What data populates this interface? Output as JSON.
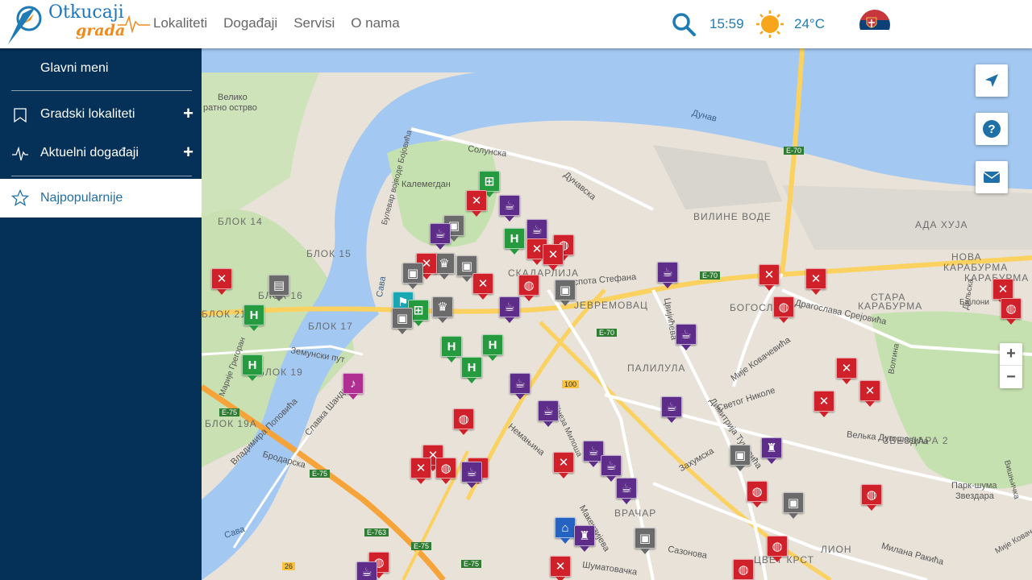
{
  "header": {
    "logo": {
      "line1": "Otkucaji",
      "line2": "grada"
    },
    "nav": [
      {
        "label": "Lokaliteti"
      },
      {
        "label": "Događaji"
      },
      {
        "label": "Servisi"
      },
      {
        "label": "O nama"
      }
    ],
    "time": "15:59",
    "temperature": "24°C",
    "language_flag": "serbia-flag-icon"
  },
  "sidebar": {
    "title": "Glavni meni",
    "items": [
      {
        "label": "Gradski lokaliteti",
        "icon": "bookmark-icon",
        "expand": "+"
      },
      {
        "label": "Aktuelni događaji",
        "icon": "pulse-icon",
        "expand": "+"
      },
      {
        "label": "Najpopularnije",
        "icon": "star-icon",
        "active": true
      }
    ]
  },
  "map": {
    "labels": {
      "veliko1": "Велико",
      "veliko2": "ратно острво",
      "dunav": "Дунав",
      "solunska": "Солунска",
      "kalemegdan": "Калемегдан",
      "dunavska": "Дунавска",
      "blok14": "БЛОК 14",
      "blok15": "БЛОК 15",
      "blok16": "БЛОК 16",
      "blok17": "БЛОК 17",
      "blok19": "БЛОК 19",
      "blok21": "БЛОК 21",
      "blok19a": "БЛОК 19А",
      "vilineVode": "ВИЛИНЕ ВОДЕ",
      "adaHuja": "АДА ХУЈА",
      "novaKaraburma1": "НОВА",
      "novaKaraburma2": "КАРАБУРМА",
      "karaburma": "КАРАБУРМА",
      "staraKaraburma1": "СТАРА",
      "staraKaraburma2": "КАРАБУРМА",
      "skadarlija": "СКАДАРЛИЈА",
      "jevremovac": "ЈЕВРЕМОВАЦ",
      "palilula": "ПАЛИЛУЛА",
      "bogoslovija": "БОГОСЛО",
      "vracar": "ВРАЧАР",
      "zvezdara": "ЗВЕЗДАРА 2",
      "lion": "ЛИОН",
      "park1": "Парк-шума",
      "park2": "Звездара",
      "sava1": "Сава",
      "sava2": "Сава",
      "zemunskiPut": "Земунски пут",
      "despotaStefana": "Деспота Стефана",
      "cvijiceva": "Цвијићева",
      "mijeKovacevica": "Мије Ковачевића",
      "dragoslavaSrejovica": "Драгослава Срејовића",
      "svetogNikole": "Светог Николе",
      "zahumska": "Захумска",
      "makenzijeva": "Макензијева",
      "nemanjina": "Немањина",
      "sumatovacka": "Шуматовачка",
      "sazonova": "Сазонова",
      "milanaRakica": "Милана Ракића",
      "velkaDugosevica": "Велька Дугошевића",
      "gvozdenaKapija": "Кнеза Милоша",
      "brodarska": "Бродарска",
      "vladimiraPopovica": "Владимира Поповића",
      "slavkaSandera": "Славка Шандера",
      "bulevar": "Булевар војводе Бојовића",
      "dimitrijaTucovica": "Димитрија Туцовића",
      "cvetaKrst": "ЦВЕТ КРСТ",
      "e70a": "E-70",
      "e70b": "E-70",
      "e70c": "E-70",
      "e75a": "E-75",
      "e75b": "E-75",
      "e75c": "E-75",
      "e75d": "E-75",
      "e763": "E-763",
      "r100": "100",
      "r26": "26",
      "mariie": "Марије Грегоран",
      "dilska": "Дильска",
      "volgina": "Волгина",
      "visnjicka": "Вишњичка",
      "bajlonija": "Бајлони",
      "jug": "Мије Ковачевића"
    },
    "buttons": {
      "locate": "navigate-icon",
      "help": "help-icon",
      "mail": "mail-icon",
      "zoom_in": "+",
      "zoom_out": "−"
    },
    "markers": [
      {
        "type": "restaurant",
        "color": "red",
        "glyph": "✕"
      },
      {
        "type": "cafe",
        "color": "purple",
        "glyph": "☕"
      },
      {
        "type": "hotel",
        "color": "green",
        "glyph": "H"
      },
      {
        "type": "museum",
        "color": "gray",
        "glyph": "▣"
      },
      {
        "type": "bakery",
        "color": "red",
        "glyph": "◍"
      },
      {
        "type": "nightlife",
        "color": "pink",
        "glyph": "♪"
      },
      {
        "type": "shopping",
        "color": "green",
        "glyph": "⊞"
      },
      {
        "type": "wine",
        "color": "purple",
        "glyph": "♜"
      },
      {
        "type": "cinema",
        "color": "gray",
        "glyph": "▤"
      },
      {
        "type": "theatre",
        "color": "gray",
        "glyph": "♛"
      },
      {
        "type": "hospital",
        "color": "blue",
        "glyph": "⌂"
      },
      {
        "type": "sport",
        "color": "teal",
        "glyph": "⚑"
      }
    ]
  }
}
